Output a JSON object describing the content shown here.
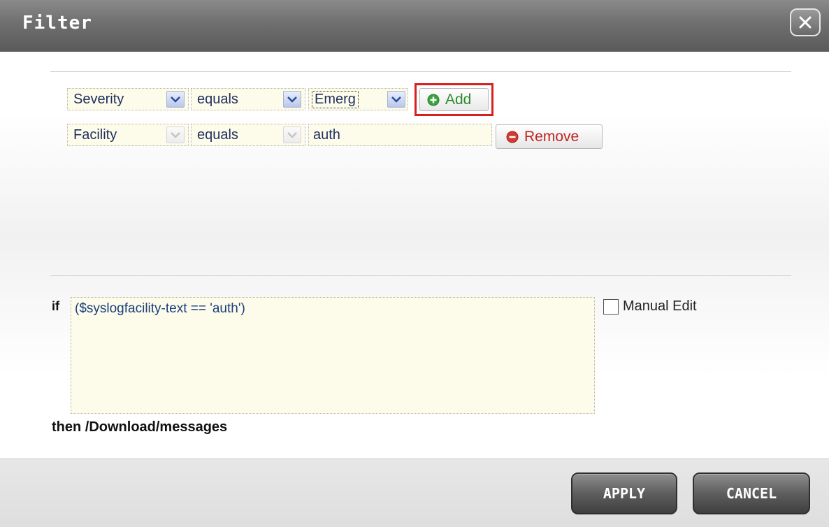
{
  "dialog": {
    "title": "Filter",
    "close_label": "X"
  },
  "rules": [
    {
      "field": "Severity",
      "operator": "equals",
      "value": "Emerg",
      "button": "Add"
    },
    {
      "field": "Facility",
      "operator": "equals",
      "value": "auth",
      "button": "Remove"
    }
  ],
  "condition": {
    "if_label": "if",
    "expression": "($syslogfacility-text == 'auth')",
    "manual_edit_label": "Manual Edit",
    "manual_edit_checked": false,
    "then_label": "then /Download/messages"
  },
  "footer": {
    "apply_label": "APPLY",
    "cancel_label": "CANCEL"
  },
  "colors": {
    "add_highlight": "#d8211e",
    "add_text": "#2b8a2b",
    "remove_text": "#c0241f",
    "field_bg": "#fdfbe9"
  },
  "icons": {
    "close": "close-icon",
    "add": "plus-circle-icon",
    "remove": "minus-circle-icon",
    "dropdown": "chevron-down-icon"
  }
}
